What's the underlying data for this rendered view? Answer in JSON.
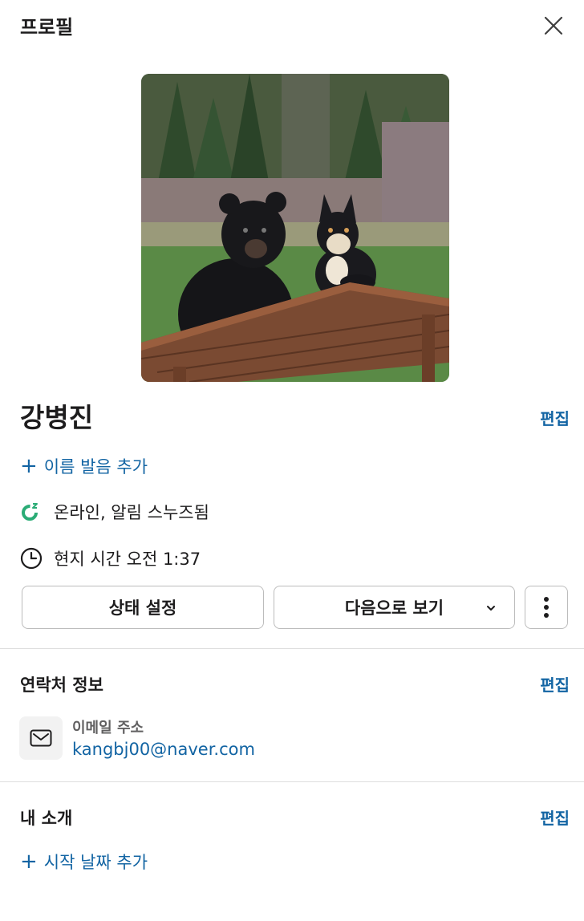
{
  "header": {
    "title": "프로필"
  },
  "profile": {
    "name": "강병진",
    "edit_label": "편집",
    "add_pronunciation": "이름 발음 추가",
    "status": "온라인, 알림 스누즈됨",
    "local_time": "현지 시간 오전 1:37"
  },
  "actions": {
    "set_status": "상태 설정",
    "view_as": "다음으로 보기"
  },
  "contact": {
    "title": "연락처 정보",
    "edit_label": "편집",
    "email_label": "이메일 주소",
    "email": "kangbj00@naver.com"
  },
  "about": {
    "title": "내 소개",
    "edit_label": "편집",
    "add_start_date": "시작 날짜 추가"
  },
  "colors": {
    "link": "#1264a3",
    "status_icon": "#2bac76"
  },
  "icons": [
    "close-icon",
    "plus-icon",
    "snooze-status-icon",
    "clock-icon",
    "chevron-down-icon",
    "more-vertical-icon",
    "mail-icon"
  ]
}
